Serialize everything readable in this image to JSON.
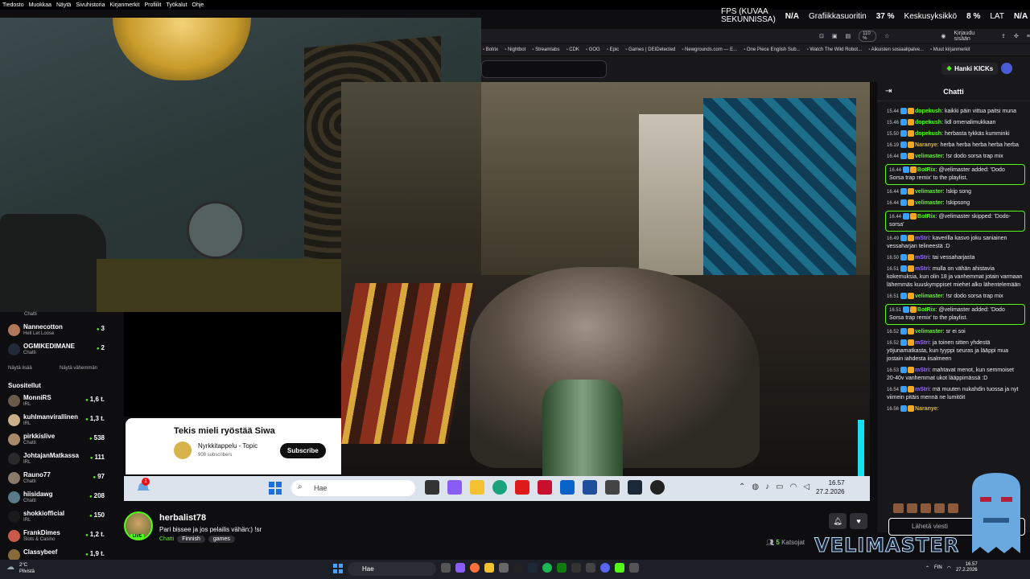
{
  "menubar": [
    "Tiedosto",
    "Muokkaa",
    "Näytä",
    "Sivuhistoria",
    "Kirjanmerkit",
    "Profiilit",
    "Työkalut",
    "Ohje"
  ],
  "fps_overlay": {
    "fps_label_1": "FPS (KUVAA",
    "fps_label_2": "SEKUNNISSA)",
    "fps_value": "N/A",
    "gpu_label": "Grafiikkasuoritin",
    "gpu_value": "37 %",
    "cpu_label": "Keskusyksikkö",
    "cpu_value": "8 %",
    "lat_label": "LAT",
    "lat_value": "N/A"
  },
  "browser": {
    "zoom": "110 %",
    "signin": "Kirjaudu sisään",
    "bookmarks": [
      "Botrix",
      "Nightbot",
      "Streamlabs",
      "CDK",
      "GOG",
      "Epic",
      "Games | DEIDetected",
      "Newgrounds.com — E...",
      "One Piece English Sub...",
      "Watch The Wild Robot...",
      "Aikuisten sosiaalipalve...",
      "Muut kirjanmerkit"
    ]
  },
  "header": {
    "kicks_button": "Hanki KICKs"
  },
  "sidebar": {
    "top_item_category": "Chatti",
    "following": [
      {
        "name": "Nannecotton",
        "category": "Hell Let Loose",
        "count": "3",
        "color": "#b07a5a"
      },
      {
        "name": "OGMIKEDIMANE",
        "category": "Chatti",
        "count": "2",
        "color": "#222a3a"
      }
    ],
    "show_more": "Näytä lisää",
    "show_less": "Näytä vähemmän",
    "recommended_title": "Suositellut",
    "recommended": [
      {
        "name": "MonniRS",
        "category": "IRL",
        "count": "1,6 t.",
        "color": "#6a5a4a"
      },
      {
        "name": "kuhlmanvirallinen",
        "category": "IRL",
        "count": "1,3 t.",
        "color": "#c9b08a"
      },
      {
        "name": "pirkkislive",
        "category": "Chatti",
        "count": "538",
        "color": "#a88a6a"
      },
      {
        "name": "JohtajanMatkassa",
        "category": "IRL",
        "count": "111",
        "color": "#2a2a2a"
      },
      {
        "name": "Rauno77",
        "category": "Chatti",
        "count": "97",
        "color": "#8a7a6a"
      },
      {
        "name": "hiisidawg",
        "category": "Chatti",
        "count": "208",
        "color": "#5a7a8a"
      },
      {
        "name": "shokkiofficial",
        "category": "IRL",
        "count": "150",
        "color": "#1a1a1a"
      },
      {
        "name": "FrankDimes",
        "category": "Slots & Casino",
        "count": "1,2 t.",
        "color": "#c95a4a"
      },
      {
        "name": "Classybeef",
        "category": "",
        "count": "1,9 t.",
        "color": "#8a6a3a"
      }
    ]
  },
  "youtube": {
    "title": "Tekis mieli ryöstää Siwa",
    "channel": "Nyrkkitappelu - Topic",
    "subscribers": "908 subscribers",
    "subscribe": "Subscribe"
  },
  "video_taskbar": {
    "search": "Hae",
    "time": "16.57",
    "date": "27.2.2026",
    "notif_badge": "1"
  },
  "stream": {
    "streamer": "herbalist78",
    "live": "LIVE",
    "title": "Pari bissee ja jos pelailis vähän:) !sr",
    "category": "Chatti",
    "tags": [
      "Finnish",
      "games"
    ],
    "viewers_count": "5",
    "viewers_label": "Katsojat"
  },
  "chat": {
    "title": "Chatti",
    "input_placeholder": "Lähetä viesti",
    "messages": [
      {
        "time": "15.44",
        "user": "dopekush",
        "color": "#53fc18",
        "text": "kaikki päin vittua paitsi muna",
        "hl": false
      },
      {
        "time": "15.46",
        "user": "dopekush",
        "color": "#53fc18",
        "text": "lidl omenalimukkaan",
        "hl": false
      },
      {
        "time": "15.50",
        "user": "dopekush",
        "color": "#53fc18",
        "text": "herbasta tykkäs kumminki",
        "hl": false
      },
      {
        "time": "16.19",
        "user": "Naranye",
        "color": "#e6b422",
        "text": "herba herba herba herba herba",
        "hl": false
      },
      {
        "time": "16.44",
        "user": "velimaster",
        "color": "#53fc18",
        "text": "!sr dodo sorsa trap mix",
        "hl": false
      },
      {
        "time": "16.44",
        "user": "BotRix",
        "color": "#53fc18",
        "text": "@velimaster added: 'Dodo Sorsa trap remix' to the playlist.",
        "hl": true
      },
      {
        "time": "16.44",
        "user": "velimaster",
        "color": "#53fc18",
        "text": "!skip song",
        "hl": false
      },
      {
        "time": "16.44",
        "user": "velimaster",
        "color": "#53fc18",
        "text": "!skipsong",
        "hl": false
      },
      {
        "time": "16.44",
        "user": "BotRix",
        "color": "#53fc18",
        "text": "@velimaster skipped: 'Dodo-sorsa'",
        "hl": true
      },
      {
        "time": "16.49",
        "user": "mStri",
        "color": "#9b6bff",
        "text": "kaverilla kasvo joku saniainen vessaharjan telineestä :D",
        "hl": false
      },
      {
        "time": "16.50",
        "user": "mStri",
        "color": "#9b6bff",
        "text": "tai vessaharjasta",
        "hl": false
      },
      {
        "time": "16.51",
        "user": "mStri",
        "color": "#9b6bff",
        "text": "mulla on vähän ahistavia kokemuksia, kun olin 18 ja vanhemmat jotain varmaan lähemmäs kuuskymppiset miehet alko lähentelemään",
        "hl": false
      },
      {
        "time": "16.51",
        "user": "velimaster",
        "color": "#53fc18",
        "text": "!sr dodo sorsa trap mix",
        "hl": false
      },
      {
        "time": "16.51",
        "user": "BotRix",
        "color": "#53fc18",
        "text": "@velimaster added: 'Dodo Sorsa trap remix' to the playlist.",
        "hl": true
      },
      {
        "time": "16.52",
        "user": "velimaster",
        "color": "#53fc18",
        "text": "sr ei soi",
        "hl": false
      },
      {
        "time": "16.52",
        "user": "mStri",
        "color": "#9b6bff",
        "text": "ja toinen sitten yhdestä yöjunamatkasta, kun tyyppi seuras ja lääppi mua jostain iahdesta iisalmeen",
        "hl": false
      },
      {
        "time": "16.53",
        "user": "mStri",
        "color": "#9b6bff",
        "text": "mahtavat menot, kun semmoiset 20-40v vanhemmat ukot lääppimässä :D",
        "hl": false
      },
      {
        "time": "16.54",
        "user": "mStri",
        "color": "#9b6bff",
        "text": "mä muuten nukahdin tuossa ja nyt viimein pitäis mennä ne lumitöit",
        "hl": false
      },
      {
        "time": "16.56",
        "user": "Naranye",
        "color": "#e6b422",
        "text": "",
        "hl": false
      }
    ]
  },
  "overlay_logo": "VELIMASTER",
  "taskbar": {
    "weather_temp": "2°C",
    "weather_desc": "Pilvistä",
    "search": "Hae",
    "lang": "FIN",
    "time": "16.57",
    "date": "27.2.2026"
  }
}
